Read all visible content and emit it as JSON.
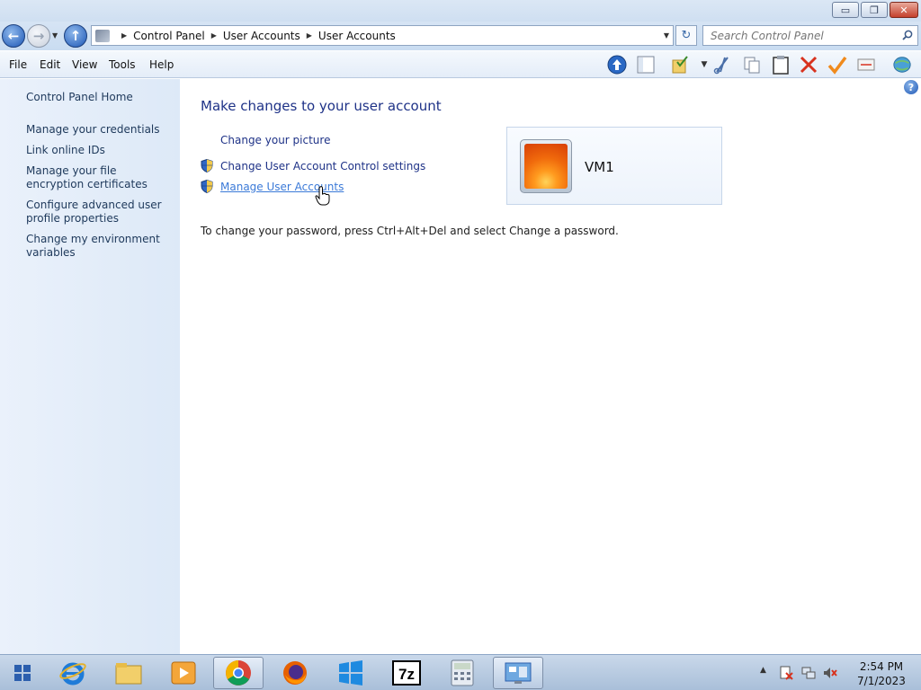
{
  "window": {
    "controls": {
      "minimize": "▭",
      "maximize": "❐",
      "close": "✕"
    }
  },
  "address": {
    "breadcrumbs": [
      "Control Panel",
      "User Accounts",
      "User Accounts"
    ],
    "search_placeholder": "Search Control Panel"
  },
  "menu": [
    "File",
    "Edit",
    "View",
    "Tools",
    "Help"
  ],
  "toolbar_icons": [
    "up-arrow-icon",
    "panel-icon",
    "folder-check-icon",
    "scissors-icon",
    "copy-icon",
    "paste-icon",
    "delete-icon",
    "checkmark-icon",
    "properties-icon",
    "globe-icon"
  ],
  "sidebar": {
    "home": "Control Panel Home",
    "links": [
      "Manage your credentials",
      "Link online IDs",
      "Manage your file encryption certificates",
      "Configure advanced user profile properties",
      "Change my environment variables"
    ]
  },
  "main": {
    "title": "Make changes to your user account",
    "tasks": [
      {
        "label": "Change your picture",
        "shield": false
      },
      {
        "label": "Change User Account Control settings",
        "shield": true
      },
      {
        "label": "Manage User Accounts",
        "shield": true
      }
    ],
    "account": {
      "name": "VM1"
    },
    "password_note": "To change your password, press Ctrl+Alt+Del and select Change a password."
  },
  "taskbar": {
    "apps": [
      "start",
      "internet-explorer",
      "file-explorer",
      "media-player",
      "chrome",
      "firefox",
      "windows-store",
      "7zip",
      "calculator",
      "control-panel"
    ],
    "time": "2:54 PM",
    "date": "7/1/2023"
  },
  "colors": {
    "link": "#1e3287",
    "sidebar_link": "#1e395b",
    "close_button": "#c4402b"
  }
}
